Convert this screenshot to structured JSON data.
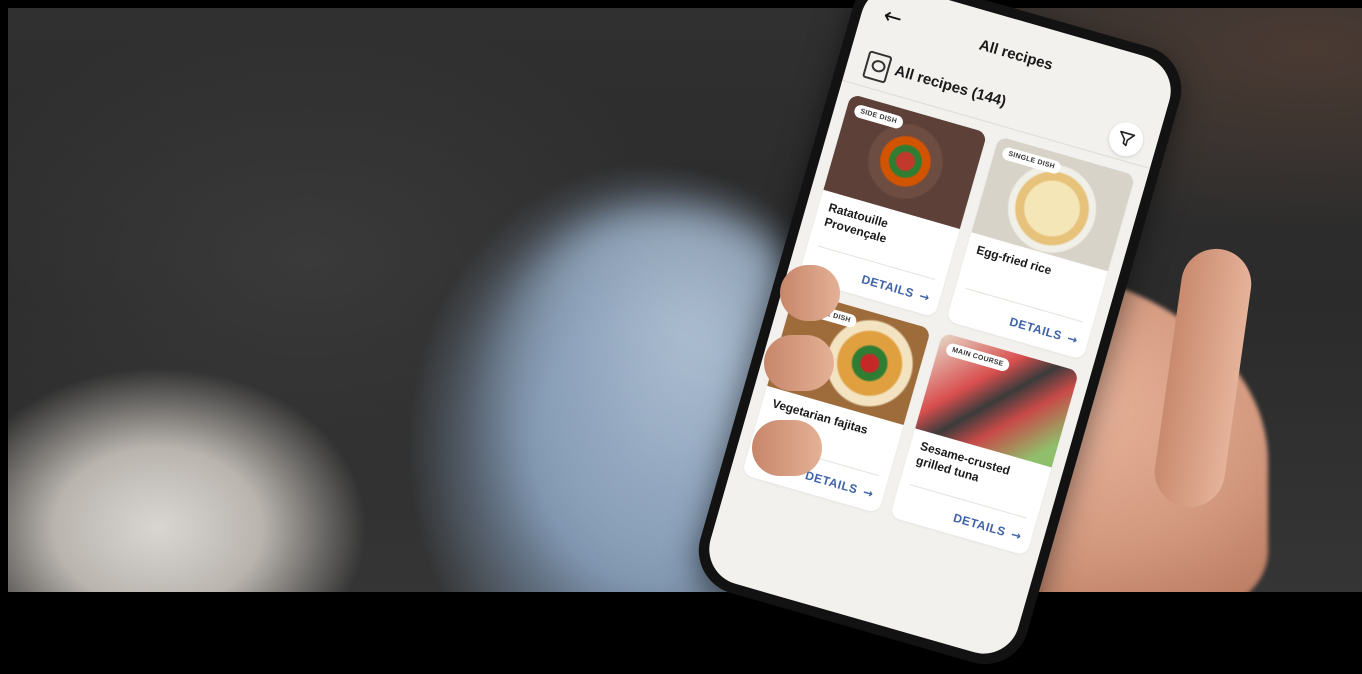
{
  "app": {
    "header_title": "All recipes",
    "list_title": "All recipes (144)",
    "icons": {
      "back": "arrow-left-icon",
      "book": "recipe-book-icon",
      "filter": "filter-icon"
    }
  },
  "recipes": [
    {
      "category": "SIDE DISH",
      "name": "Ratatouille Provençale",
      "action": "DETAILS"
    },
    {
      "category": "SINGLE DISH",
      "name": "Egg-fried rice",
      "action": "DETAILS"
    },
    {
      "category": "SINGLE DISH",
      "name": "Vegetarian fajitas",
      "action": "DETAILS"
    },
    {
      "category": "MAIN COURSE",
      "name": "Sesame-crusted grilled tuna",
      "action": "DETAILS"
    }
  ]
}
